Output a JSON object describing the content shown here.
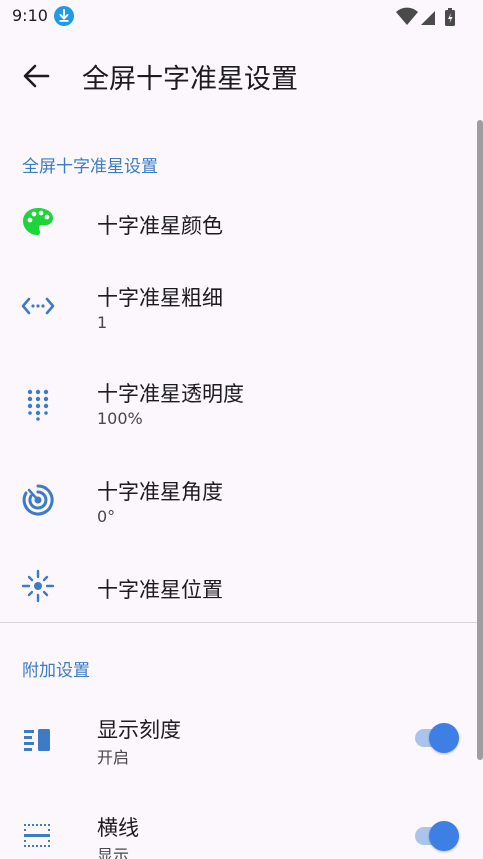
{
  "status_bar": {
    "time": "9:10"
  },
  "app_bar": {
    "title": "全屏十字准星设置"
  },
  "sections": [
    {
      "header": "全屏十字准星设置",
      "items": [
        {
          "title": "十字准星颜色",
          "summary": "",
          "icon": "palette-icon"
        },
        {
          "title": "十字准星粗细",
          "summary": "1",
          "icon": "line-weight-icon"
        },
        {
          "title": "十字准星透明度",
          "summary": "100%",
          "icon": "opacity-dots-icon"
        },
        {
          "title": "十字准星角度",
          "summary": "0°",
          "icon": "rotate-target-icon"
        },
        {
          "title": "十字准星位置",
          "summary": "",
          "icon": "position-sun-icon"
        }
      ]
    },
    {
      "header": "附加设置",
      "items": [
        {
          "title": "显示刻度",
          "summary": "开启",
          "icon": "scale-icon",
          "switch_on": true
        },
        {
          "title": "横线",
          "summary": "显示",
          "icon": "horizontal-lines-icon",
          "switch_on": true
        }
      ]
    }
  ],
  "colors": {
    "accent": "#3D7BC4",
    "icon_blue": "#3D7BC4",
    "palette_green": "#1FD33A",
    "switch_thumb": "#3E7FE6",
    "switch_track": "#A9C5EE",
    "background": "#FBF7FC"
  }
}
